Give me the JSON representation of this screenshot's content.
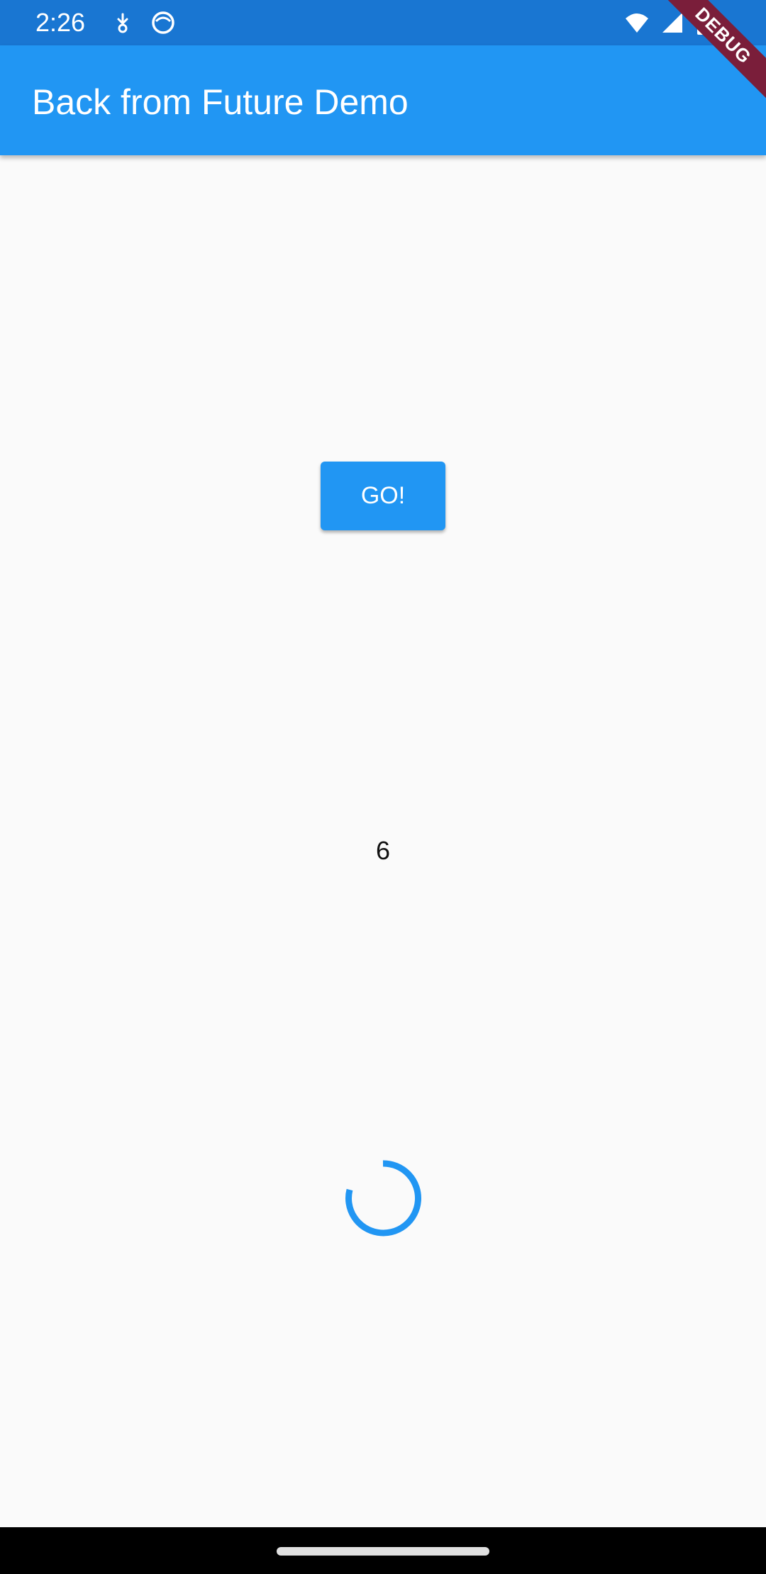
{
  "status_bar": {
    "time": "2:26",
    "icons": [
      "download-notification-icon",
      "smiley-notification-icon",
      "wifi-icon",
      "cellular-signal-icon",
      "battery-icon"
    ]
  },
  "app_bar": {
    "title": "Back from Future Demo"
  },
  "debug_banner": {
    "label": "DEBUG"
  },
  "main": {
    "go_button_label": "GO!",
    "counter_value": "6"
  },
  "colors": {
    "primary": "#2196f3",
    "status_bar": "#1976d2",
    "background": "#fafafa",
    "debug_banner": "#7a1e3a"
  }
}
